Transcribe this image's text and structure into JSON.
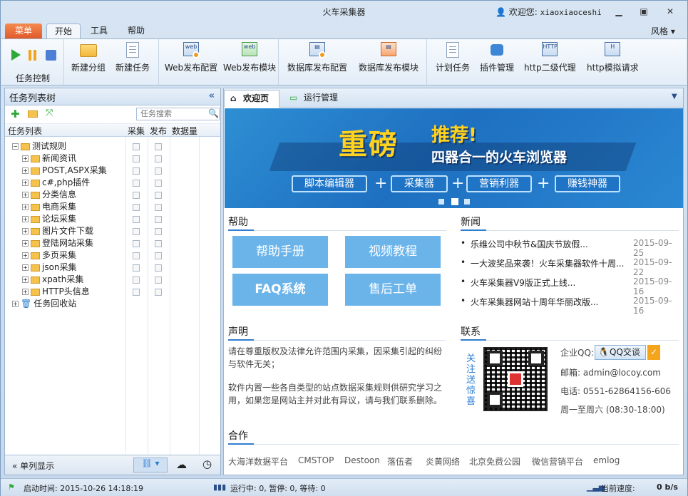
{
  "window": {
    "title": "火车采集器",
    "user_prefix": "欢迎您:",
    "user_name": "xiaoxiaoceshi"
  },
  "ribbon_tabs": {
    "menu": "菜单",
    "start": "开始",
    "tools": "工具",
    "help": "帮助",
    "style": "风格"
  },
  "ribbon": {
    "task_control": "任务控制",
    "buttons": [
      "新建分组",
      "新建任务",
      "Web发布配置",
      "Web发布模块",
      "数据库发布配置",
      "数据库发布模块",
      "计划任务",
      "插件管理",
      "http二级代理",
      "http模拟请求"
    ]
  },
  "left_panel": {
    "title": "任务列表树",
    "search_placeholder": "任务搜索",
    "columns": [
      "任务列表",
      "采集",
      "发布",
      "数据量"
    ],
    "root": "测试规则",
    "children": [
      "新闻资讯",
      "POST,ASPX采集",
      "c#,php插件",
      "分类信息",
      "电商采集",
      "论坛采集",
      "图片文件下载",
      "登陆网站采集",
      "多页采集",
      "json采集",
      "xpath采集",
      "HTTP头信息"
    ],
    "recycle": "任务回收站",
    "footer_label": "单列显示"
  },
  "tabs": {
    "welcome": "欢迎页",
    "run": "运行管理"
  },
  "banner": {
    "title": "重磅",
    "recommend": "推荐!",
    "subtitle": "四器合一的火车浏览器",
    "boxes": [
      "脚本编辑器",
      "采集器",
      "营销利器",
      "赚钱神器"
    ],
    "plus": "+"
  },
  "help": {
    "title": "帮助",
    "buttons": [
      "帮助手册",
      "视频教程",
      "FAQ系统",
      "售后工单"
    ]
  },
  "news": {
    "title": "新闻",
    "items": [
      {
        "t": "乐维公司中秋节&国庆节放假...",
        "d": "2015-09-25"
      },
      {
        "t": "一大波奖品来袭！火车采集器软件十周...",
        "d": "2015-09-22"
      },
      {
        "t": "火车采集器V9版正式上线...",
        "d": "2015-09-16"
      },
      {
        "t": "火车采集器网站十周年华丽改版...",
        "d": "2015-09-16"
      }
    ]
  },
  "statement": {
    "title": "声明",
    "p1": "请在尊重版权及法律允许范围内采集，因采集引起的纠纷与软件无关；",
    "p2": "软件内置一些各自类型的站点数据采集规则供研究学习之用，如果您是网站主并对此有异议，请与我们联系删除。"
  },
  "contact": {
    "title": "联系",
    "follow": "关注送惊喜",
    "qq_label": "企业QQ:",
    "qq_btn": "QQ交谈",
    "email": "邮箱: admin@locoy.com",
    "phone": "电话: 0551-62864156-606",
    "hours": "周一至周六 (08:30-18:00)"
  },
  "partners": {
    "title": "合作",
    "items": [
      "大海洋数据平台",
      "CMSTOP",
      "Destoon",
      "落伍者",
      "炎黄网络",
      "北京免费公园",
      "微信营销平台",
      "emlog"
    ]
  },
  "status": {
    "start_time": "启动时间: 2015-10-26 14:18:19",
    "running": "运行中: 0, 暂停: 0, 等待: 0",
    "speed_label": "当前速度:",
    "speed": "0 b/s"
  },
  "colors": {
    "accent": "#2f7ed0",
    "help_btn": "#6bb4ea",
    "menu_tab": "#e0572a"
  }
}
